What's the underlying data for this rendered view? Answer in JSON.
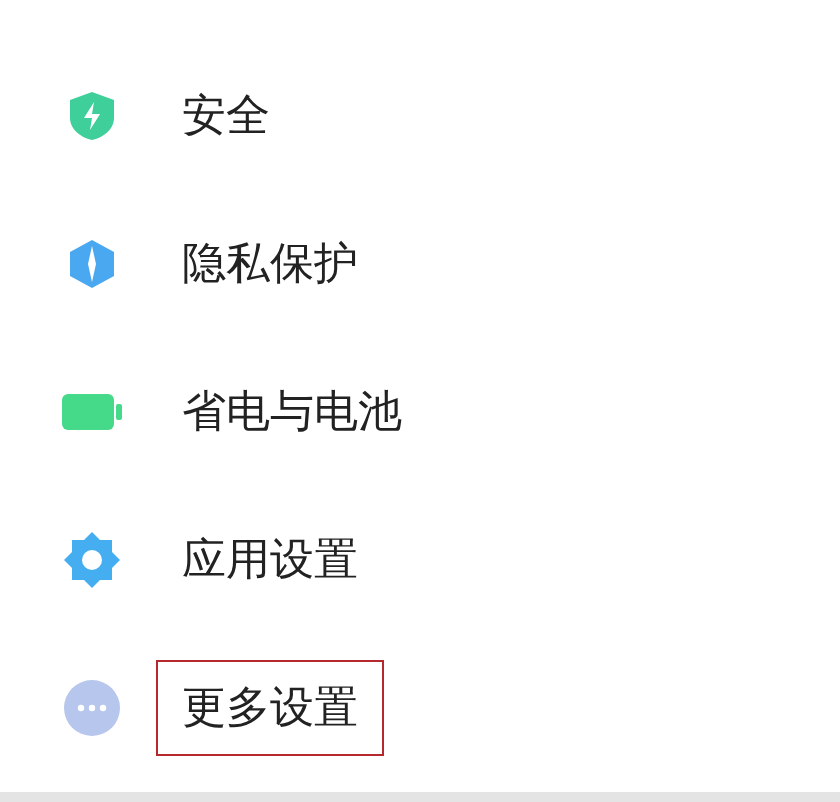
{
  "settings_items": [
    {
      "label": "安全",
      "kind": "security",
      "highlighted": false
    },
    {
      "label": "隐私保护",
      "kind": "privacy",
      "highlighted": false
    },
    {
      "label": "省电与电池",
      "kind": "battery",
      "highlighted": false
    },
    {
      "label": "应用设置",
      "kind": "apps",
      "highlighted": false
    },
    {
      "label": "更多设置",
      "kind": "more",
      "highlighted": true
    }
  ]
}
